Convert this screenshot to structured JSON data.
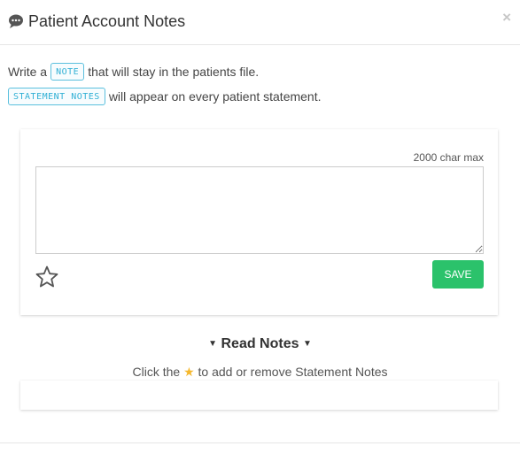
{
  "header": {
    "title": "Patient Account Notes",
    "title_icon": "comment-icon",
    "close_label": "×"
  },
  "intro": {
    "line1_prefix": "Write a",
    "line1_tag": "NOTE",
    "line1_suffix": "that will stay in the patients file.",
    "line2_tag": "STATEMENT NOTES",
    "line2_suffix": "will appear on every patient statement."
  },
  "editor": {
    "char_max": "2000 char max",
    "note_value": "",
    "placeholder": "",
    "star_icon": "star-outline-icon",
    "save_label": "SAVE"
  },
  "read_notes": {
    "label": "Read Notes",
    "caret": "▼",
    "hint_prefix": "Click the",
    "hint_icon": "★",
    "hint_suffix": "to add or remove Statement Notes"
  },
  "colors": {
    "save_button": "#2bc26b",
    "tag_border": "#5bc0de",
    "star_hint": "#f5b82e"
  }
}
